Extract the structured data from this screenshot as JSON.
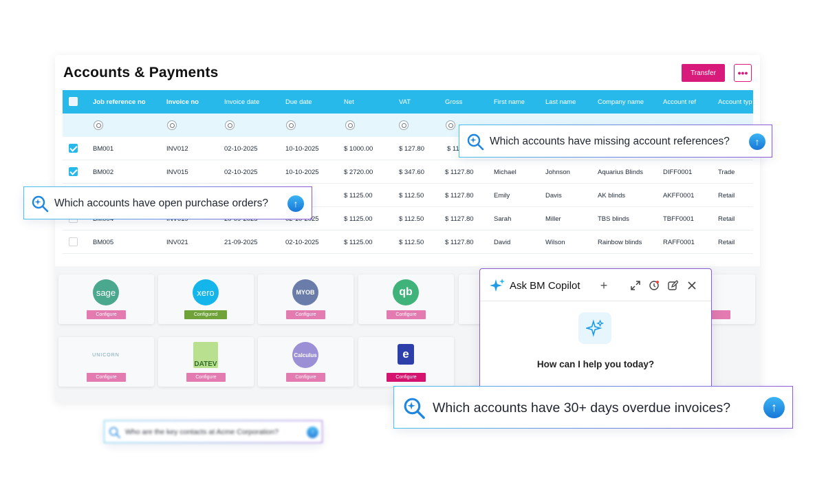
{
  "page": {
    "title": "Accounts & Payments",
    "transfer_label": "Transfer",
    "more_label": "•••"
  },
  "table": {
    "columns": [
      "Job reference no",
      "Invoice no",
      "Invoice date",
      "Due date",
      "Net",
      "VAT",
      "Gross",
      "First name",
      "Last name",
      "Company name",
      "Account ref",
      "Account typ"
    ],
    "rows": [
      {
        "checked": true,
        "job": "BM001",
        "inv": "INV012",
        "inv_date": "02-10-2025",
        "due": "10-10-2025",
        "net": "$ 1000.00",
        "vat": "$ 127.80",
        "gross": "$ 11",
        "first": "",
        "last": "",
        "company": "",
        "acc_ref": "",
        "acc_type": ""
      },
      {
        "checked": true,
        "job": "BM002",
        "inv": "INV015",
        "inv_date": "02-10-2025",
        "due": "10-10-2025",
        "net": "$ 2720.00",
        "vat": "$ 347.60",
        "gross": "$ 1127.80",
        "first": "Michael",
        "last": "Johnson",
        "company": "Aquarius Blinds",
        "acc_ref": "DIFF0001",
        "acc_type": "Trade"
      },
      {
        "checked": false,
        "job": "",
        "inv": "",
        "inv_date": "",
        "due": "",
        "net": "$ 1125.00",
        "vat": "$ 112.50",
        "gross": "$ 1127.80",
        "first": "Emily",
        "last": "Davis",
        "company": "AK blinds",
        "acc_ref": "AKFF0001",
        "acc_type": "Retail"
      },
      {
        "checked": false,
        "job": "BM004",
        "inv": "INV019",
        "inv_date": "20-09-2025",
        "due": "02-10-2025",
        "net": "$ 1125.00",
        "vat": "$ 112.50",
        "gross": "$ 1127.80",
        "first": "Sarah",
        "last": "Miller",
        "company": "TBS blinds",
        "acc_ref": "TBFF0001",
        "acc_type": "Retail"
      },
      {
        "checked": false,
        "job": "BM005",
        "inv": "INV021",
        "inv_date": "21-09-2025",
        "due": "02-10-2025",
        "net": "$ 1125.00",
        "vat": "$ 112.50",
        "gross": "$ 1127.80",
        "first": "David",
        "last": "Wilson",
        "company": "Rainbow blinds",
        "acc_ref": "RAFF0001",
        "acc_type": "Retail"
      }
    ]
  },
  "integrations": [
    {
      "name": "sage",
      "logo_text": "sage",
      "color": "#4aa88e",
      "button": "Configure",
      "state": "default"
    },
    {
      "name": "xero",
      "logo_text": "xero",
      "color": "#13b5ea",
      "button": "Configured",
      "state": "configured"
    },
    {
      "name": "myob",
      "logo_text": "MYOB",
      "color": "#6a7caa",
      "button": "Configure",
      "state": "default"
    },
    {
      "name": "quickbooks",
      "logo_text": "qb",
      "color": "#3fb37a",
      "button": "Configure",
      "state": "default"
    },
    {
      "name": "unicorn",
      "logo_text": "UNICORN",
      "color": "#7aa5b8",
      "button": "Configure",
      "state": "default"
    },
    {
      "name": "datev",
      "logo_text": "DATEV",
      "color": "#9bcf6a",
      "button": "Configure",
      "state": "default"
    },
    {
      "name": "calculus",
      "logo_text": "Calculus",
      "color": "#9b8fd6",
      "button": "Configure",
      "state": "default"
    },
    {
      "name": "e-invoice",
      "logo_text": "e",
      "color": "#2d3fa8",
      "button": "Configure",
      "state": "highlight"
    },
    {
      "name": "hidden-right-1",
      "logo_text": "",
      "color": "#dddddd",
      "button": "",
      "state": "default"
    }
  ],
  "prompts": {
    "missing_refs": "Which accounts have missing account references?",
    "open_po": "Which accounts have open purchase orders?",
    "overdue": "Which accounts have 30+ days overdue invoices?",
    "key_contacts": "Who are the key contacts at Acme Corporation?"
  },
  "copilot": {
    "title": "Ask BM Copilot",
    "help": "How can I help you today?"
  },
  "colors": {
    "accent": "#27b9ea",
    "brand_pink": "#d81b7a",
    "copilot_border": "#8a5bd6"
  }
}
